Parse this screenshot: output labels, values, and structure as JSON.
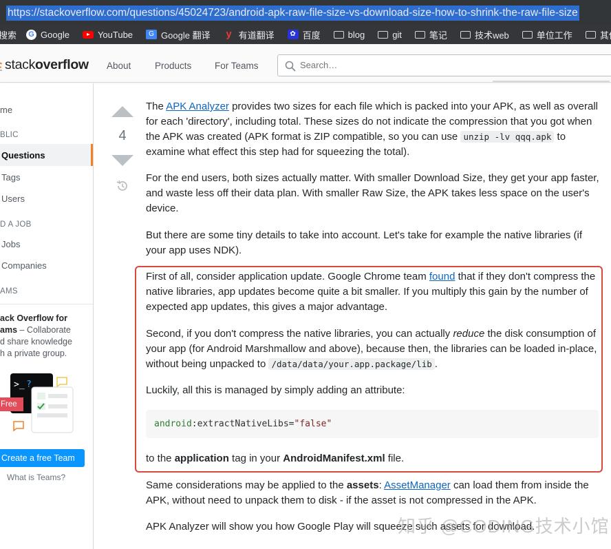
{
  "browser": {
    "url": "https://stackoverflow.com/questions/45024723/android-apk-raw-file-size-vs-download-size-how-to-shrink-the-raw-file-size",
    "bookmarks": [
      {
        "label": "搜索",
        "icon": "none"
      },
      {
        "label": "Google",
        "icon": "google-icon"
      },
      {
        "label": "YouTube",
        "icon": "youtube-icon"
      },
      {
        "label": "Google 翻译",
        "icon": "google-translate-icon"
      },
      {
        "label": "有道翻译",
        "icon": "youdao-icon"
      },
      {
        "label": "百度",
        "icon": "baidu-icon"
      },
      {
        "label": "blog",
        "icon": "folder-icon"
      },
      {
        "label": "git",
        "icon": "folder-icon"
      },
      {
        "label": "笔记",
        "icon": "folder-icon"
      },
      {
        "label": "技术web",
        "icon": "folder-icon"
      },
      {
        "label": "单位工作",
        "icon": "folder-icon"
      },
      {
        "label": "其他",
        "icon": "folder-icon"
      }
    ]
  },
  "header": {
    "logo_light": "stack",
    "logo_bold": "overflow",
    "nav": [
      "About",
      "Products",
      "For Teams"
    ],
    "search_placeholder": "Search…"
  },
  "sidebar": {
    "home": "me",
    "public": "BLIC",
    "questions": "Questions",
    "tags": "Tags",
    "users": "Users",
    "find_job": "D A JOB",
    "jobs": "Jobs",
    "companies": "Companies",
    "teams": "AMS",
    "teams_promo": [
      "ack Overflow for",
      "ams",
      " – Collaborate",
      "d share knowledge",
      "h a private group."
    ],
    "free_badge": "Free",
    "create_team": "Create a free Team",
    "what_is_teams": "What is Teams?"
  },
  "post": {
    "vote_count": "4",
    "p1": {
      "a": "The ",
      "link": "APK Analyzer",
      "b": " provides two sizes for each file which is packed into your APK, as well as overall for each 'directory', including total. These sizes do not indicate the compression that you got when the APK was created (APK format is ZIP compatible, so you can use ",
      "code": "unzip -lv qqq.apk",
      "c": " to examine what effect this step had for squeezing the total)."
    },
    "p2": "For the end users, both sizes actually matter. With smaller Download Size, they get your app faster, and waste less off their data plan. With smaller Raw Size, the APK takes less space on the user's device.",
    "p3": "But there are some tiny details to take into account. Let's take for example the native libraries (if your app uses NDK).",
    "p4": {
      "a": "First of all, consider application update. Google Chrome team ",
      "link": "found",
      "b": " that if they don't compress the native libraries, app updates become quite a bit smaller. If you multiply this gain by the number of expected app updates, this gives a major advantage."
    },
    "p5": {
      "a": "Second, if you don't compress the native libraries, you can actually ",
      "em": "reduce",
      "b": " the disk consumption of your app (for Android Marshmallow and above), because then, the libraries can be loaded in-place, without being unpacked to ",
      "code": "/data/data/your.app.package/lib",
      "c": "."
    },
    "p6": "Luckily, all this is managed by simply adding an attribute:",
    "code_ns": "android",
    "code_attr": ":extractNativeLibs=",
    "code_val": "\"false\"",
    "p7": {
      "a": "to the ",
      "b1": "application",
      "b": " tag in your ",
      "b2": "AndroidManifest.xml",
      "c": " file."
    },
    "p8": {
      "a": "Same considerations may be applied to the ",
      "b1": "assets",
      "b": ": ",
      "link": "AssetManager",
      "c": " can load them from inside the APK, without need to unpack them to disk - if the asset is not compressed in the APK."
    },
    "p9": "APK Analyzer will show you how Google Play will squeeze such assets for download."
  },
  "watermark": "知乎 @CODING技术小馆",
  "colors": {
    "accent": "#f48024",
    "link": "#0c65c2",
    "highlight": "#d9473a",
    "button": "#0a95ff"
  }
}
